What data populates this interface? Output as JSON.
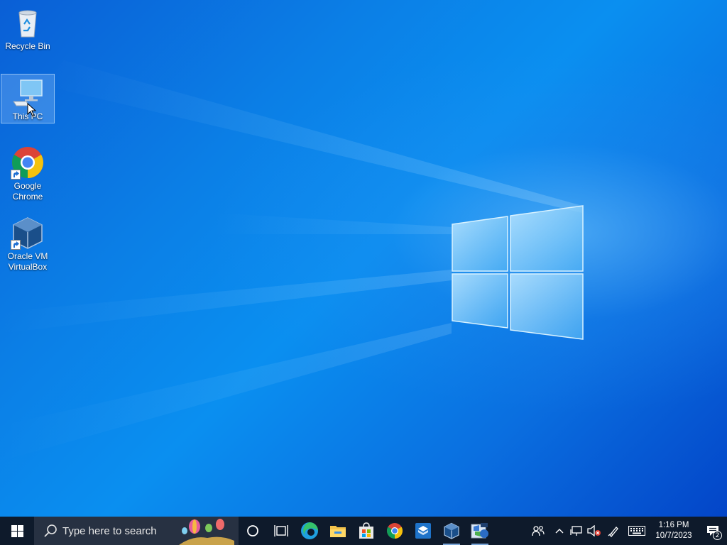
{
  "desktop": {
    "icons": [
      {
        "label": "Recycle Bin",
        "icon": "recycle-bin-icon"
      },
      {
        "label": "This PC",
        "icon": "computer-icon",
        "selected": true
      },
      {
        "label": "Google\nChrome",
        "icon": "chrome-icon",
        "shortcut": true
      },
      {
        "label": "Oracle VM\nVirtualBox",
        "icon": "virtualbox-icon",
        "shortcut": true
      }
    ]
  },
  "taskbar": {
    "search": {
      "placeholder": "Type here to search"
    },
    "apps": [
      {
        "name": "cortana",
        "icon": "cortana-circle-icon"
      },
      {
        "name": "task-view",
        "icon": "task-view-icon"
      },
      {
        "name": "edge",
        "icon": "edge-icon"
      },
      {
        "name": "file-explorer",
        "icon": "folder-icon"
      },
      {
        "name": "microsoft-store",
        "icon": "store-icon"
      },
      {
        "name": "chrome",
        "icon": "chrome-icon"
      },
      {
        "name": "app-box",
        "icon": "app-box-icon"
      },
      {
        "name": "virtualbox",
        "icon": "virtualbox-icon",
        "running": true
      },
      {
        "name": "windows-xp-vm",
        "icon": "xp-vm-icon",
        "running": true
      }
    ],
    "tray": {
      "time": "1:16 PM",
      "date": "10/7/2023",
      "notification_count": "2"
    }
  },
  "colors": {
    "taskbar_bg": "#0e1a2b",
    "search_bg": "#273142",
    "desktop_accent": "#0a7fe6"
  }
}
